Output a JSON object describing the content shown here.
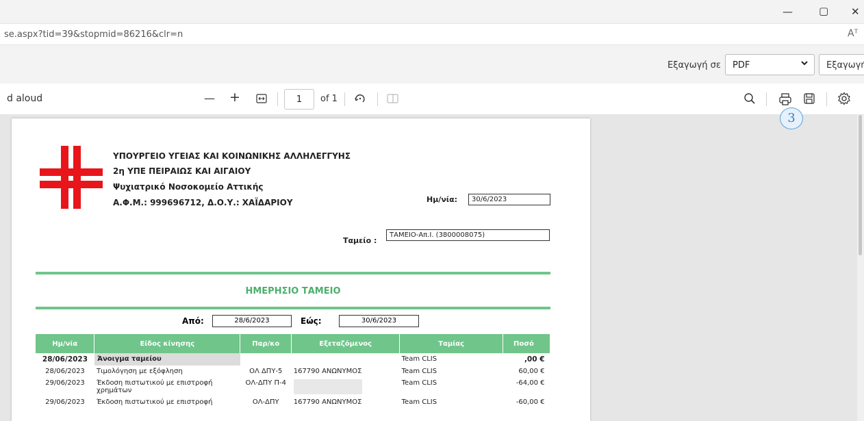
{
  "window": {
    "minimize_glyph": "—",
    "restore_glyph": "▢",
    "close_glyph": "✕"
  },
  "address_bar": {
    "url": "se.aspx?tid=39&stopmid=86216&clr=n",
    "read_aloud_glyph": "Aᵀ"
  },
  "export_bar": {
    "label": "Εξαγωγή σε",
    "format_selected": "PDF",
    "export_button": "Εξαγωγή"
  },
  "pdf_toolbar": {
    "read_aloud": "d aloud",
    "zoom_out": "—",
    "zoom_in": "+",
    "current_page": "1",
    "of_pages": "of 1"
  },
  "badge": "3",
  "document": {
    "org_lines": [
      "ΥΠΟΥΡΓΕΙΟ ΥΓΕΙΑΣ ΚΑΙ ΚΟΙΝΩΝΙΚΗΣ ΑΛΛΗΛΕΓΓΥΗΣ",
      "2η ΥΠΕ ΠΕΙΡΑΙΩΣ ΚΑΙ ΑΙΓΑΙΟΥ",
      "Ψυχιατρικό Νοσοκομείο Αττικής",
      "Α.Φ.Μ.: 999696712, Δ.Ο.Υ.: ΧΑΪΔΑΡΙΟΥ"
    ],
    "date_label": "Ημ/νία:",
    "date_value": "30/6/2023",
    "cashbox_label": "Ταμείο :",
    "cashbox_value": "ΤΑΜΕΙΟ-Απ.Ι. (3800008075)",
    "title": "ΗΜΕΡΗΣΙΟ ΤΑΜΕΙΟ",
    "from_label": "Από:",
    "from_value": "28/6/2023",
    "to_label": "Εώς:",
    "to_value": "30/6/2023",
    "columns": [
      "Ημ/νία",
      "Είδος κίνησης",
      "Παρ/κο",
      "Εξεταζόμενος",
      "Ταμίας",
      "Ποσό"
    ],
    "rows": [
      {
        "date": "28/06/2023",
        "kind": "Άνοιγμα ταμείου",
        "par": "",
        "examinee": "",
        "cashier": "Team CLIS",
        "amount": ",00 €"
      },
      {
        "date": "28/06/2023",
        "kind": "Τιμολόγηση με εξόφληση",
        "par": "ΟΛ ΔΠΥ-5",
        "examinee": "167790 ΑΝΩΝΥΜΟΣ",
        "cashier": "Team CLIS",
        "amount": "60,00 €"
      },
      {
        "date": "29/06/2023",
        "kind": "Έκδοση πιστωτικού με επιστροφή χρημάτων",
        "par": "ΟΛ-ΔΠΥ Π-4",
        "examinee": "",
        "cashier": "Team CLIS",
        "amount": "-64,00 €"
      },
      {
        "date": "29/06/2023",
        "kind": "Έκδοση πιστωτικού με επιστροφή",
        "par": "ΟΛ-ΔΠΥ",
        "examinee": "167790 ΑΝΩΝΥΜΟΣ",
        "cashier": "Team CLIS",
        "amount": "-60,00 €"
      }
    ]
  },
  "colors": {
    "accent_green": "#70c58a",
    "logo_red": "#e8151b",
    "title_green": "#4caf6a"
  }
}
